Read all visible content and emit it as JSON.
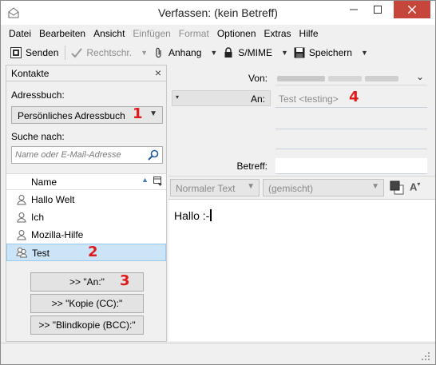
{
  "window": {
    "title": "Verfassen: (kein Betreff)"
  },
  "menubar": {
    "items": [
      {
        "label": "Datei",
        "enabled": true
      },
      {
        "label": "Bearbeiten",
        "enabled": true
      },
      {
        "label": "Ansicht",
        "enabled": true
      },
      {
        "label": "Einfügen",
        "enabled": false
      },
      {
        "label": "Format",
        "enabled": false
      },
      {
        "label": "Optionen",
        "enabled": true
      },
      {
        "label": "Extras",
        "enabled": true
      },
      {
        "label": "Hilfe",
        "enabled": true
      }
    ]
  },
  "toolbar": {
    "send_label": "Senden",
    "spell_label": "Rechtschr.",
    "attach_label": "Anhang",
    "smime_label": "S/MIME",
    "save_label": "Speichern"
  },
  "sidebar": {
    "title": "Kontakte",
    "addressbook_label": "Adressbuch:",
    "addressbook_value": "Persönliches Adressbuch",
    "search_label": "Suche nach:",
    "search_placeholder": "Name oder E-Mail-Adresse",
    "column_name": "Name",
    "contacts": [
      {
        "name": "Hallo Welt",
        "type": "person",
        "selected": false
      },
      {
        "name": "Ich",
        "type": "person",
        "selected": false
      },
      {
        "name": "Mozilla-Hilfe",
        "type": "person",
        "selected": false
      },
      {
        "name": "Test",
        "type": "list",
        "selected": true
      }
    ],
    "buttons": {
      "to": ">> \"An:\"",
      "cc": ">> \"Kopie (CC):\"",
      "bcc": ">> \"Blindkopie (BCC):\""
    }
  },
  "compose": {
    "from_label": "Von:",
    "to_label": "An:",
    "to_value": "Test <testing>",
    "subject_label": "Betreff:",
    "subject_value": ""
  },
  "format_bar": {
    "paragraph_style": "Normaler Text",
    "font": "(gemischt)"
  },
  "editor": {
    "body_text": "Hallo :-"
  },
  "annotations": {
    "m1": "1",
    "m2": "2",
    "m3": "3",
    "m4": "4"
  },
  "colors": {
    "marker": "#e01a1a",
    "selected_row": "#cce4f7",
    "close_button": "#c7463c"
  }
}
